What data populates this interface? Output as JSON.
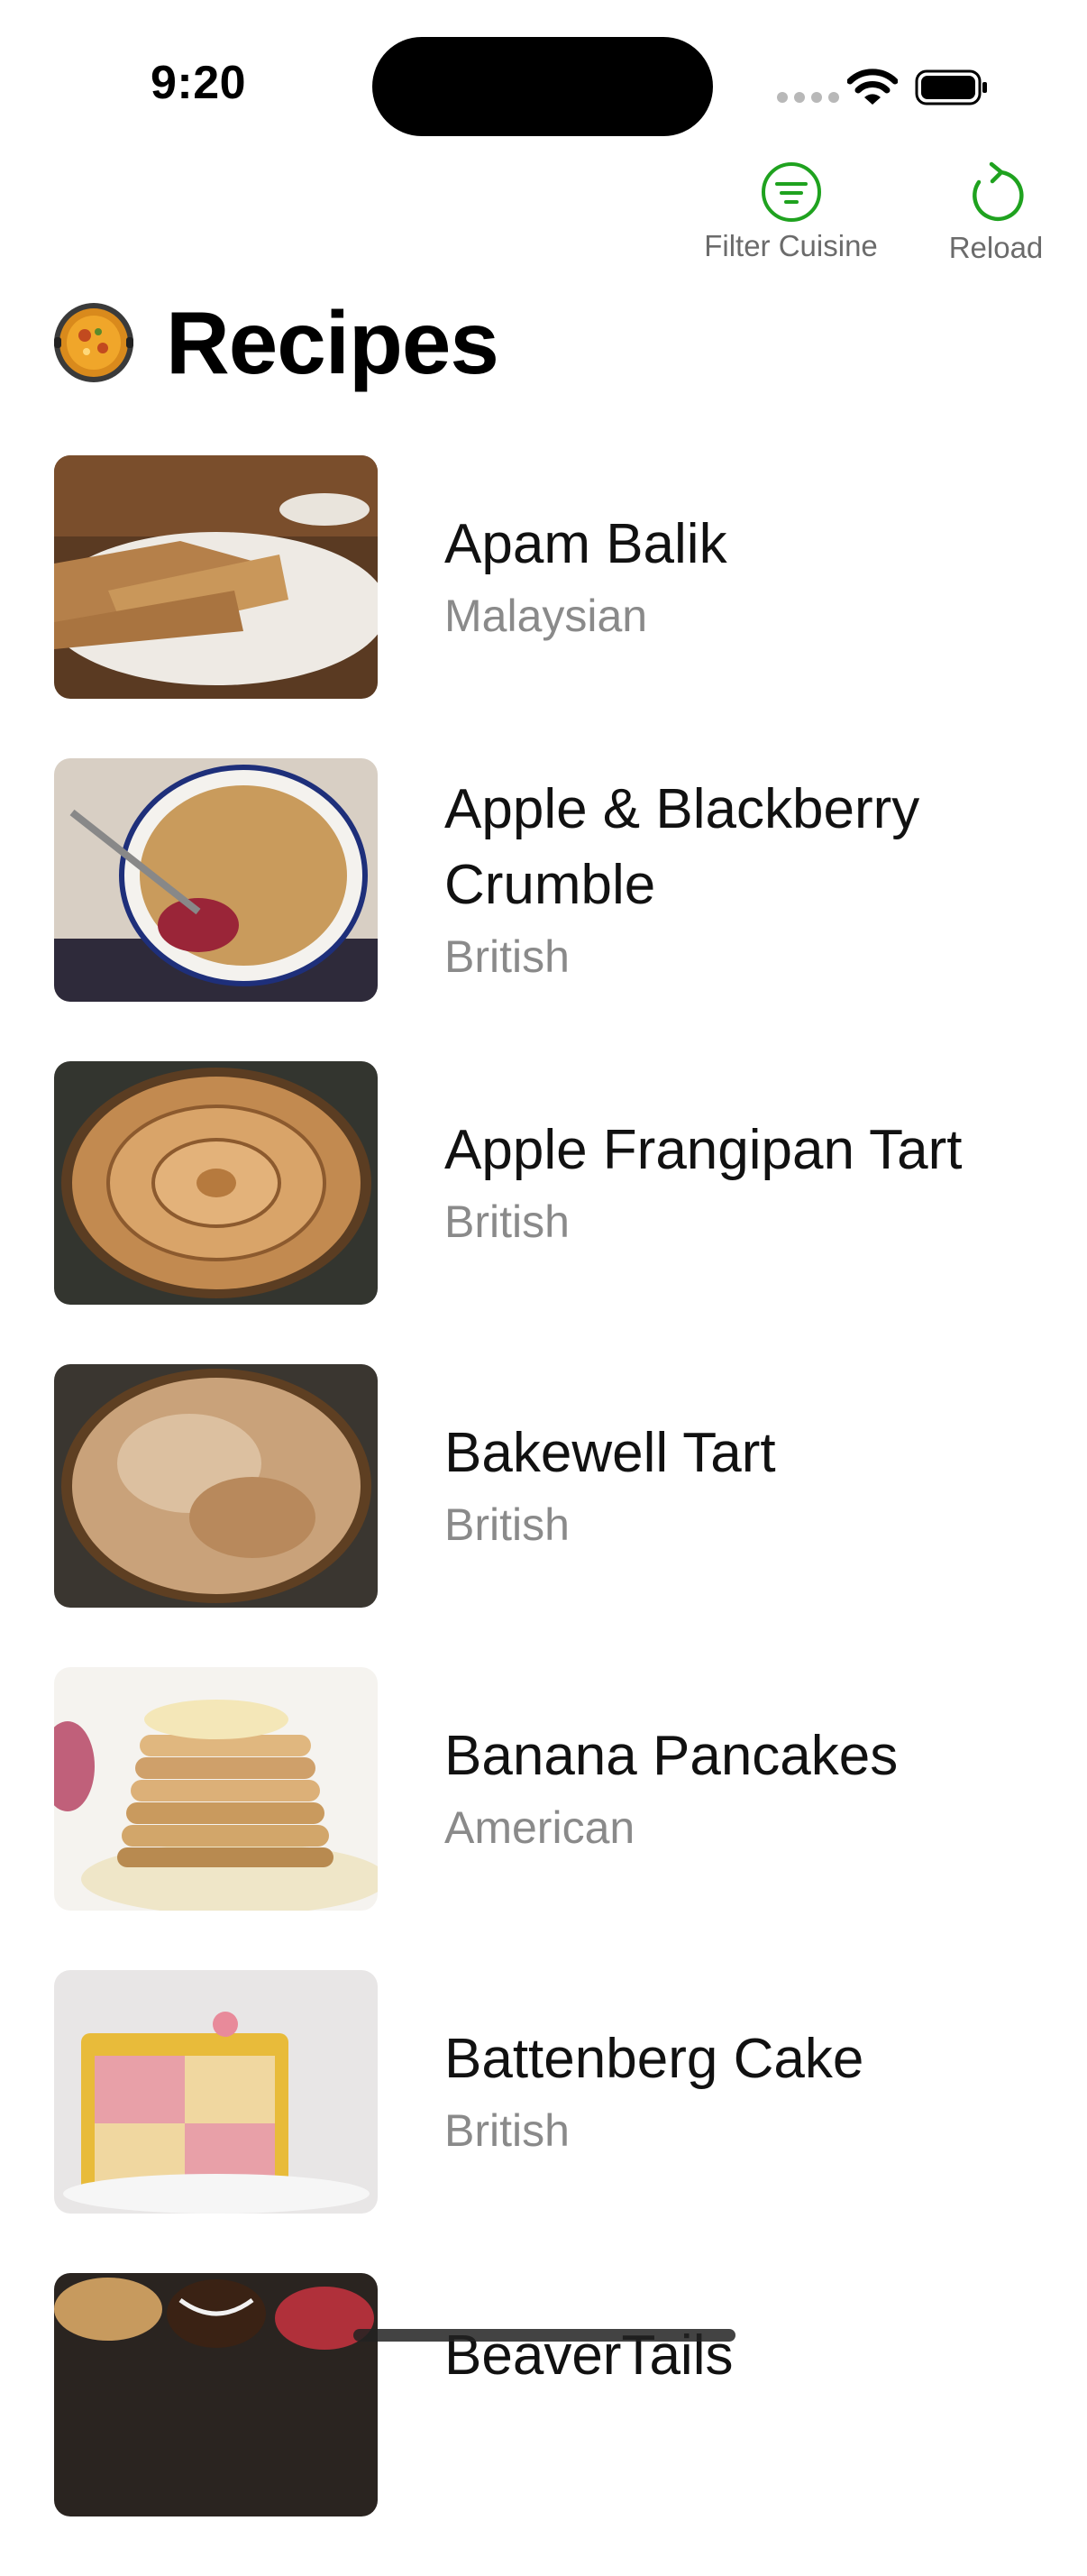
{
  "status_bar": {
    "time": "9:20"
  },
  "toolbar": {
    "filter_label": "Filter Cuisine",
    "reload_label": "Reload",
    "accent_color": "#1fa21f"
  },
  "header": {
    "title": "Recipes"
  },
  "recipes": [
    {
      "name": "Apam Balik",
      "cuisine": "Malaysian"
    },
    {
      "name": "Apple & Blackberry Crumble",
      "cuisine": "British"
    },
    {
      "name": "Apple Frangipan Tart",
      "cuisine": "British"
    },
    {
      "name": "Bakewell Tart",
      "cuisine": "British"
    },
    {
      "name": "Banana Pancakes",
      "cuisine": "American"
    },
    {
      "name": "Battenberg Cake",
      "cuisine": "British"
    },
    {
      "name": "BeaverTails",
      "cuisine": ""
    }
  ]
}
